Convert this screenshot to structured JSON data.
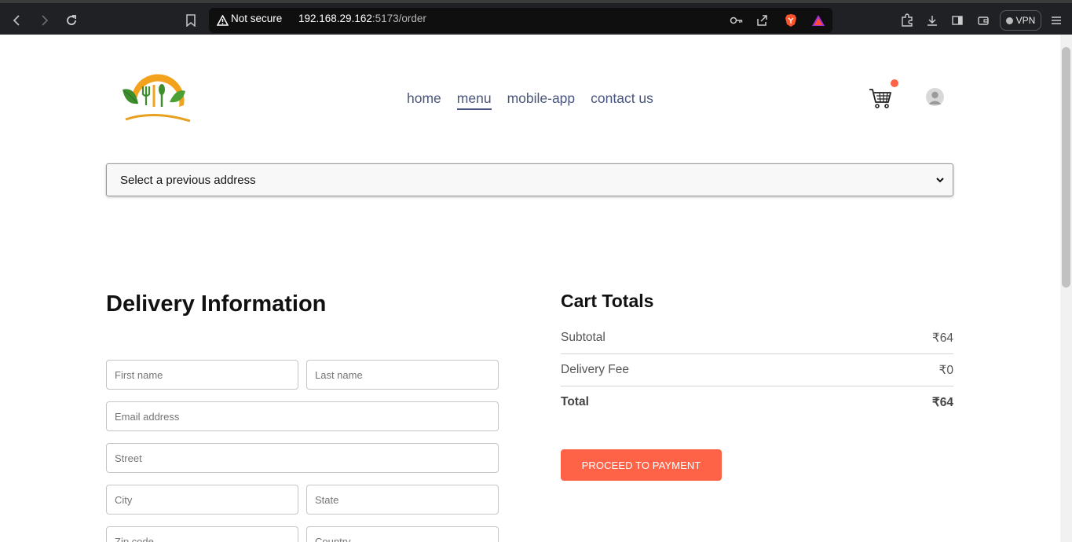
{
  "browser": {
    "security_label": "Not secure",
    "url_host": "192.168.29.162",
    "url_path": ":5173/order",
    "vpn_label": "VPN"
  },
  "nav": {
    "links": [
      "home",
      "menu",
      "mobile-app",
      "contact us"
    ],
    "active": "menu"
  },
  "address_select": {
    "selected": "Select a previous address"
  },
  "delivery": {
    "title": "Delivery Information",
    "placeholders": {
      "first_name": "First name",
      "last_name": "Last name",
      "email": "Email address",
      "street": "Street",
      "city": "City",
      "state": "State",
      "zip": "Zip code",
      "country": "Country"
    }
  },
  "cart_totals": {
    "title": "Cart Totals",
    "subtotal_label": "Subtotal",
    "subtotal_value": "₹64",
    "delivery_label": "Delivery Fee",
    "delivery_value": "₹0",
    "total_label": "Total",
    "total_value": "₹64",
    "button_label": "PROCEED TO PAYMENT"
  },
  "colors": {
    "accent": "#ff6347",
    "nav_text": "#49557e",
    "chrome_bg": "#202124"
  }
}
